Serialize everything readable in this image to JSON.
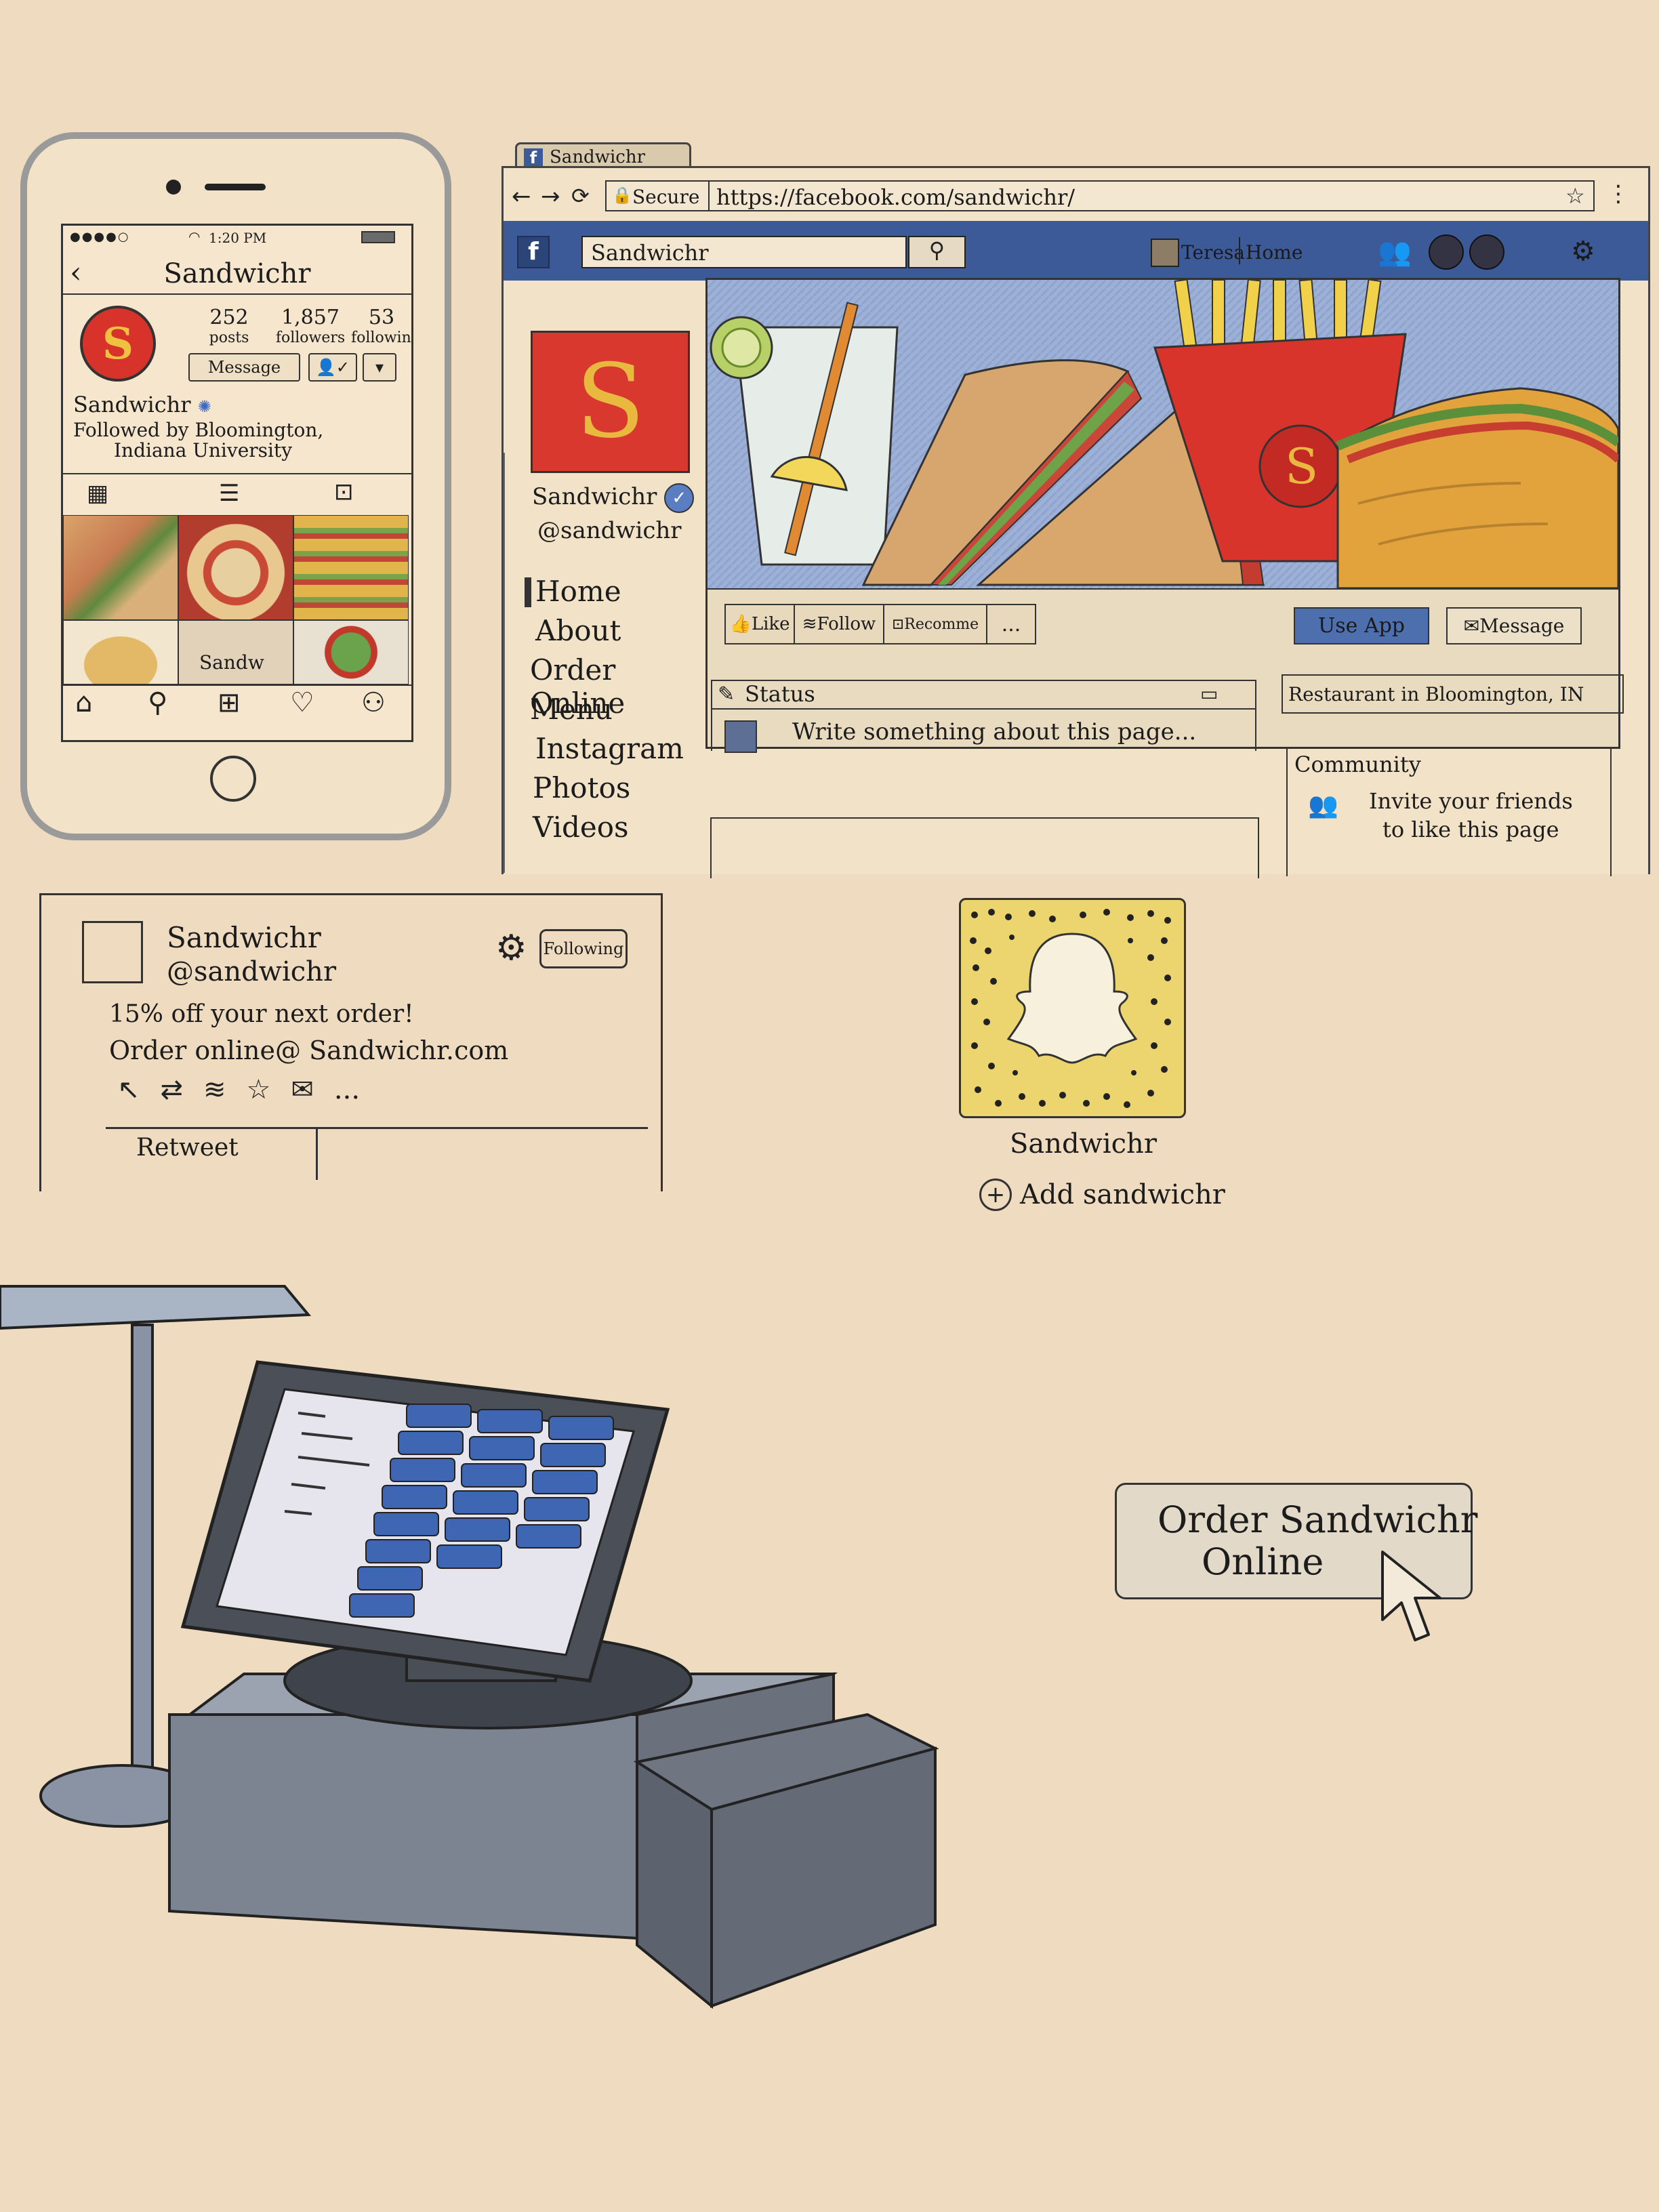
{
  "phone": {
    "status": {
      "time": "1:20 PM"
    },
    "title": "Sandwichr",
    "avatar_letter": "S",
    "stats": [
      {
        "value": "252",
        "label": "posts"
      },
      {
        "value": "1,857",
        "label": "followers"
      },
      {
        "value": "53",
        "label": "following"
      }
    ],
    "message_label": "Message",
    "name": "Sandwichr",
    "followed_by": "Followed by Bloomington,",
    "followed_by_2": "Indiana University",
    "grid_caption": "Sandw"
  },
  "browser": {
    "tab_title": "Sandwichr",
    "address": {
      "secure": "Secure",
      "url": "https://facebook.com/sandwichr/"
    },
    "search_value": "Sandwichr",
    "topbar": {
      "user": "Teresa",
      "home": "Home"
    },
    "page_avatar_letter": "S",
    "page_name": "Sandwichr",
    "page_handle": "@sandwichr",
    "nav": [
      "Home",
      "About",
      "Order Online",
      "Menu",
      "Instagram",
      "Photos",
      "Videos"
    ],
    "actions": {
      "like": "Like",
      "follow": "Follow",
      "recommend": "Recomme",
      "more": "...",
      "use_app": "Use App",
      "message": "Message"
    },
    "status_label": "Status",
    "composer_placeholder": "Write something about this page...",
    "category": "Restaurant in Bloomington, IN",
    "community_title": "Community",
    "invite_text": "Invite your friends",
    "invite_text_2": "to like this page"
  },
  "tweet": {
    "name": "Sandwichr",
    "handle": "@sandwichr",
    "following_label": "Following",
    "line1": "15% off your next order!",
    "line2": "Order online@ Sandwichr.com",
    "more": "...",
    "retweet_label": "Retweet"
  },
  "snapchat": {
    "name": "Sandwichr",
    "add_label": "Add sandwichr"
  },
  "order_button": {
    "line1": "Order Sandwichr",
    "line2": "Online"
  },
  "colors": {
    "paper": "#efdcc0",
    "facebook_blue": "#3d5a98",
    "brand_red": "#d8332a",
    "brand_gold": "#f0c040",
    "snap_yellow": "#ecd56f",
    "pos_blue": "#3f66b3"
  },
  "icons": [
    "signal-icon",
    "wifi-icon",
    "battery-icon",
    "back-chevron-icon",
    "verified-badge-icon",
    "add-user-icon",
    "grid-icon",
    "list-icon",
    "tag-icon",
    "home-icon",
    "search-icon",
    "add-post-icon",
    "heart-icon",
    "profile-icon",
    "home-button-icon",
    "facebook-logo-icon",
    "back-arrow-icon",
    "forward-arrow-icon",
    "reload-icon",
    "lock-icon",
    "star-icon",
    "menu-dots-icon",
    "friends-icon",
    "messages-icon",
    "notifications-icon",
    "pencil-icon",
    "camera-icon",
    "user-icon",
    "community-icon",
    "gear-icon",
    "reply-icon",
    "retweet-icon",
    "stack-icon",
    "favorite-icon",
    "mail-icon",
    "ghost-icon",
    "add-circle-icon",
    "cursor-icon"
  ]
}
